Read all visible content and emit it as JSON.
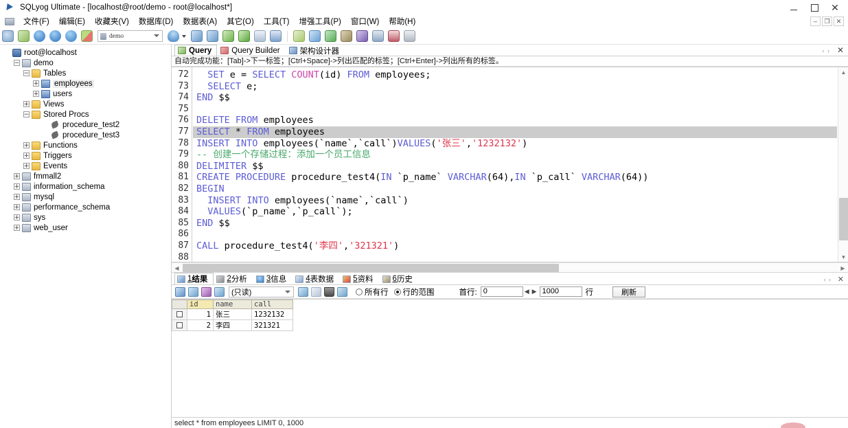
{
  "window": {
    "title": "SQLyog Ultimate - [localhost@root/demo - root@localhost*]",
    "icon": "sqlyog-logo-icon",
    "minimize": "–",
    "maximize": "□",
    "close": "✕",
    "mdi_minimize": "–",
    "mdi_restore": "❐",
    "mdi_close": "✕"
  },
  "menubar": {
    "items": [
      {
        "label": "文件(F)"
      },
      {
        "label": "编辑(E)"
      },
      {
        "label": "收藏夹(V)"
      },
      {
        "label": "数据库(D)"
      },
      {
        "label": "数据表(A)"
      },
      {
        "label": "其它(O)"
      },
      {
        "label": "工具(T)"
      },
      {
        "label": "增强工具(P)"
      },
      {
        "label": "窗口(W)"
      },
      {
        "label": "帮助(H)"
      }
    ]
  },
  "toolbar": {
    "database_selector": {
      "value": "demo",
      "icon": "database-icon"
    },
    "icons": [
      {
        "name": "new-connection-icon",
        "color": "#8aa6c8"
      },
      {
        "name": "refresh-object-browser-icon",
        "color": "#9bc06a"
      },
      {
        "name": "new-query-tab-icon",
        "color": "#3f7fd0"
      },
      {
        "name": "open-query-icon",
        "color": "#3f7fd0"
      },
      {
        "name": "save-query-icon",
        "color": "#4d93d8"
      },
      {
        "name": "query-builder-icon",
        "color": "#8fbd4a"
      },
      {
        "name": "execute-query-icon",
        "color": "#4a9b52"
      },
      {
        "name": "execute-all-queries-icon",
        "color": "#4a9b52"
      },
      {
        "name": "stop-query-icon",
        "color": "#6dbb4a"
      },
      {
        "name": "execute-current-icon",
        "color": "#5aa83c"
      },
      {
        "name": "format-sql-icon",
        "color": "#7f9fc4"
      },
      {
        "name": "table-data-icon",
        "color": "#5e88bd"
      },
      {
        "name": "sql-formatter-icon",
        "color": "#a8c86a"
      },
      {
        "name": "import-icon",
        "color": "#6aa0d4"
      },
      {
        "name": "sync-data-icon",
        "color": "#57ab57"
      },
      {
        "name": "backup-icon",
        "color": "#9a8a5e"
      },
      {
        "name": "export-icon",
        "color": "#7a5fb0"
      },
      {
        "name": "schema-sync-icon",
        "color": "#8fa8c6"
      },
      {
        "name": "table-diagnostics-icon",
        "color": "#c05d6a"
      },
      {
        "name": "user-manager-icon",
        "color": "#b0b8c2"
      }
    ]
  },
  "tree": {
    "nodes": [
      {
        "label": "root@localhost",
        "icon": "server-icon",
        "depth": 0,
        "expander": "",
        "selected": false
      },
      {
        "label": "demo",
        "icon": "database-icon",
        "depth": 1,
        "expander": "−",
        "selected": false
      },
      {
        "label": "Tables",
        "icon": "folder-icon",
        "depth": 2,
        "expander": "−",
        "selected": false
      },
      {
        "label": "employees",
        "icon": "table-icon",
        "depth": 3,
        "expander": "+",
        "selected": true
      },
      {
        "label": "users",
        "icon": "table-icon",
        "depth": 3,
        "expander": "+",
        "selected": false
      },
      {
        "label": "Views",
        "icon": "folder-icon",
        "depth": 2,
        "expander": "+",
        "selected": false
      },
      {
        "label": "Stored Procs",
        "icon": "folder-icon",
        "depth": 2,
        "expander": "−",
        "selected": false
      },
      {
        "label": "procedure_test2",
        "icon": "procedure-icon",
        "depth": 4,
        "expander": "",
        "selected": false
      },
      {
        "label": "procedure_test3",
        "icon": "procedure-icon",
        "depth": 4,
        "expander": "",
        "selected": false
      },
      {
        "label": "Functions",
        "icon": "folder-icon",
        "depth": 2,
        "expander": "+",
        "selected": false
      },
      {
        "label": "Triggers",
        "icon": "folder-icon",
        "depth": 2,
        "expander": "+",
        "selected": false
      },
      {
        "label": "Events",
        "icon": "folder-icon",
        "depth": 2,
        "expander": "+",
        "selected": false
      },
      {
        "label": "fmmall2",
        "icon": "database-icon",
        "depth": 1,
        "expander": "+",
        "selected": false
      },
      {
        "label": "information_schema",
        "icon": "database-icon",
        "depth": 1,
        "expander": "+",
        "selected": false
      },
      {
        "label": "mysql",
        "icon": "database-icon",
        "depth": 1,
        "expander": "+",
        "selected": false
      },
      {
        "label": "performance_schema",
        "icon": "database-icon",
        "depth": 1,
        "expander": "+",
        "selected": false
      },
      {
        "label": "sys",
        "icon": "database-icon",
        "depth": 1,
        "expander": "+",
        "selected": false
      },
      {
        "label": "web_user",
        "icon": "database-icon",
        "depth": 1,
        "expander": "+",
        "selected": false
      }
    ]
  },
  "editor_tabs": {
    "tabs": [
      {
        "label": "Query",
        "icon": "query-tab-icon",
        "active": true
      },
      {
        "label": "Query Builder",
        "icon": "query-builder-tab-icon",
        "active": false
      },
      {
        "label": "架构设计器",
        "icon": "schema-designer-tab-icon",
        "active": false
      }
    ],
    "close_label": "✕",
    "nav_label": "‹ ›"
  },
  "autocomplete_hint": "自动完成功能：[Tab]->下一标签；[Ctrl+Space]->列出匹配的标签；[Ctrl+Enter]->列出所有的标签。",
  "sql": {
    "first_line_number": 72,
    "selected_line": 77,
    "lines": [
      {
        "n": 72,
        "tokens": [
          {
            "t": "  ",
            "c": "pl"
          },
          {
            "t": "SET",
            "c": "kw"
          },
          {
            "t": " e ",
            "c": "pl"
          },
          {
            "t": "=",
            "c": "pl"
          },
          {
            "t": " ",
            "c": "pl"
          },
          {
            "t": "SELECT",
            "c": "kw"
          },
          {
            "t": " ",
            "c": "pl"
          },
          {
            "t": "COUNT",
            "c": "fn"
          },
          {
            "t": "(id) ",
            "c": "pl"
          },
          {
            "t": "FROM",
            "c": "kw"
          },
          {
            "t": " employees;",
            "c": "pl"
          }
        ]
      },
      {
        "n": 73,
        "tokens": [
          {
            "t": "  ",
            "c": "pl"
          },
          {
            "t": "SELECT",
            "c": "kw"
          },
          {
            "t": " e;",
            "c": "pl"
          }
        ]
      },
      {
        "n": 74,
        "tokens": [
          {
            "t": "END",
            "c": "kw"
          },
          {
            "t": " $$",
            "c": "pl"
          }
        ]
      },
      {
        "n": 75,
        "tokens": [
          {
            "t": "",
            "c": "pl"
          }
        ]
      },
      {
        "n": 76,
        "tokens": [
          {
            "t": "DELETE",
            "c": "kw"
          },
          {
            "t": " ",
            "c": "pl"
          },
          {
            "t": "FROM",
            "c": "kw"
          },
          {
            "t": " employees",
            "c": "pl"
          }
        ]
      },
      {
        "n": 77,
        "tokens": [
          {
            "t": "SELECT",
            "c": "kw"
          },
          {
            "t": " ",
            "c": "pl"
          },
          {
            "t": "*",
            "c": "pl"
          },
          {
            "t": " ",
            "c": "pl"
          },
          {
            "t": "FROM",
            "c": "kw"
          },
          {
            "t": " employees",
            "c": "pl"
          }
        ]
      },
      {
        "n": 78,
        "tokens": [
          {
            "t": "INSERT",
            "c": "kw"
          },
          {
            "t": " ",
            "c": "pl"
          },
          {
            "t": "INTO",
            "c": "kw"
          },
          {
            "t": " employees(`name`,`call`)",
            "c": "pl"
          },
          {
            "t": "VALUES",
            "c": "kw"
          },
          {
            "t": "(",
            "c": "pl"
          },
          {
            "t": "'张三'",
            "c": "str"
          },
          {
            "t": ",",
            "c": "pl"
          },
          {
            "t": "'1232132'",
            "c": "str"
          },
          {
            "t": ")",
            "c": "pl"
          }
        ]
      },
      {
        "n": 79,
        "tokens": [
          {
            "t": "-- 创建一个存储过程：添加一个员工信息",
            "c": "cmt"
          }
        ]
      },
      {
        "n": 80,
        "tokens": [
          {
            "t": "DELIMITER",
            "c": "kw"
          },
          {
            "t": " $$",
            "c": "pl"
          }
        ]
      },
      {
        "n": 81,
        "tokens": [
          {
            "t": "CREATE",
            "c": "kw"
          },
          {
            "t": " ",
            "c": "pl"
          },
          {
            "t": "PROCEDURE",
            "c": "kw"
          },
          {
            "t": " procedure_test4(",
            "c": "pl"
          },
          {
            "t": "IN",
            "c": "kw"
          },
          {
            "t": " `p_name` ",
            "c": "pl"
          },
          {
            "t": "VARCHAR",
            "c": "kw"
          },
          {
            "t": "(64),",
            "c": "pl"
          },
          {
            "t": "IN",
            "c": "kw"
          },
          {
            "t": " `p_call` ",
            "c": "pl"
          },
          {
            "t": "VARCHAR",
            "c": "kw"
          },
          {
            "t": "(64))",
            "c": "pl"
          }
        ]
      },
      {
        "n": 82,
        "tokens": [
          {
            "t": "BEGIN",
            "c": "kw"
          }
        ]
      },
      {
        "n": 83,
        "tokens": [
          {
            "t": "  ",
            "c": "pl"
          },
          {
            "t": "INSERT",
            "c": "kw"
          },
          {
            "t": " ",
            "c": "pl"
          },
          {
            "t": "INTO",
            "c": "kw"
          },
          {
            "t": " employees(`name`,`call`)",
            "c": "pl"
          }
        ]
      },
      {
        "n": 84,
        "tokens": [
          {
            "t": "  ",
            "c": "pl"
          },
          {
            "t": "VALUES",
            "c": "kw"
          },
          {
            "t": "(`p_name`,`p_call`);",
            "c": "pl"
          }
        ]
      },
      {
        "n": 85,
        "tokens": [
          {
            "t": "END",
            "c": "kw"
          },
          {
            "t": " $$",
            "c": "pl"
          }
        ]
      },
      {
        "n": 86,
        "tokens": [
          {
            "t": "",
            "c": "pl"
          }
        ]
      },
      {
        "n": 87,
        "tokens": [
          {
            "t": "CALL",
            "c": "kw"
          },
          {
            "t": " procedure_test4(",
            "c": "pl"
          },
          {
            "t": "'李四'",
            "c": "str"
          },
          {
            "t": ",",
            "c": "pl"
          },
          {
            "t": "'321321'",
            "c": "str"
          },
          {
            "t": ")",
            "c": "pl"
          }
        ]
      },
      {
        "n": 88,
        "tokens": [
          {
            "t": "",
            "c": "pl"
          }
        ]
      }
    ]
  },
  "result_tabs": {
    "tabs": [
      {
        "num": "1",
        "label": "结果",
        "icon": "result-grid-icon",
        "active": true
      },
      {
        "num": "2",
        "label": "分析",
        "icon": "profiler-icon",
        "active": false
      },
      {
        "num": "3",
        "label": "信息",
        "icon": "messages-icon",
        "active": false
      },
      {
        "num": "4",
        "label": "表数据",
        "icon": "table-data-icon",
        "active": false
      },
      {
        "num": "5",
        "label": "资料",
        "icon": "info-icon",
        "active": false
      },
      {
        "num": "6",
        "label": "历史",
        "icon": "history-icon",
        "active": false
      }
    ],
    "nav_label": "‹ ›",
    "close_label": "✕"
  },
  "grid_toolbar": {
    "icons": [
      {
        "name": "first-page-icon"
      },
      {
        "name": "edit-in-grid-icon"
      },
      {
        "name": "edit-in-form-icon"
      },
      {
        "name": "copy-row-icon"
      }
    ],
    "mode_select": {
      "value": "(只读)"
    },
    "action_icons": [
      {
        "name": "insert-row-icon"
      },
      {
        "name": "save-changes-icon"
      },
      {
        "name": "delete-row-icon"
      },
      {
        "name": "refresh-data-icon"
      }
    ],
    "radio_all_rows": {
      "label": "所有行",
      "checked": false
    },
    "radio_row_range": {
      "label": "行的范围",
      "checked": true
    },
    "first_row_label": "首行:",
    "first_row_value": "0",
    "prev_arrow": "◀",
    "next_arrow": "▶",
    "limit_value": "1000",
    "rows_label": "行",
    "refresh_button": "刷新"
  },
  "result_grid": {
    "columns": [
      "id",
      "name",
      "call"
    ],
    "highlighted_column": "id",
    "rows": [
      {
        "checkbox": false,
        "id": "1",
        "name": "张三",
        "call": "1232132",
        "current_cell": "id"
      },
      {
        "checkbox": false,
        "id": "2",
        "name": "李四",
        "call": "321321",
        "current_cell": ""
      }
    ]
  },
  "statusbar": {
    "text": "select * from employees LIMIT 0, 1000"
  },
  "colors": {
    "keyword": "#5c5cd6",
    "function": "#cc44aa",
    "string": "#e0344b",
    "comment": "#4aa96c",
    "selection": "#cccccc",
    "grid_header": "#eceadb",
    "grid_header_highlight": "#f4e9b0"
  }
}
